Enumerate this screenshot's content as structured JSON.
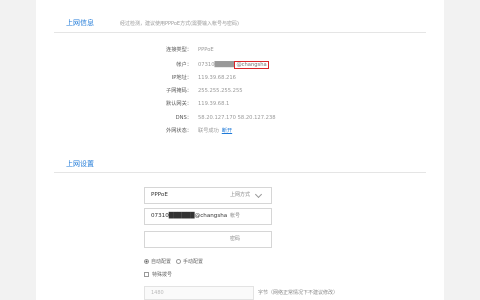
{
  "info_section": {
    "title": "上网信息",
    "hint": "经过检测，建议使用PPPoE方式(需要输入帐号与密码)",
    "rows": [
      {
        "label": "连接类型：",
        "value": "PPPoE"
      },
      {
        "label": "帐户：",
        "value_prefix": "07310",
        "value_highlight": "@changsha"
      },
      {
        "label": "IP地址：",
        "value": "119.39.68.216"
      },
      {
        "label": "子网掩码：",
        "value": "255.255.255.255"
      },
      {
        "label": "默认网关：",
        "value": "119.39.68.1"
      },
      {
        "label": "DNS：",
        "value": "58.20.127.170 58.20.127.238"
      },
      {
        "label": "外网状态：",
        "value": "联号成功",
        "link": "断开"
      }
    ]
  },
  "settings_section": {
    "title": "上网设置",
    "mode": {
      "value": "PPPoE",
      "label": "上网方式"
    },
    "account": {
      "value": "07310",
      "value_suffix": "@changsha",
      "label": "帐号"
    },
    "password": {
      "placeholder": "",
      "label": "密码"
    },
    "auto_config": "自动配置",
    "manual_config": "手动配置",
    "special_dial": "特殊拨号",
    "mtu_value": "1480",
    "mtu_note": "字节（网络正常情况下不建议修改）"
  },
  "colors": {
    "accent": "#1f7ad8",
    "highlight_border": "#d9262b"
  }
}
